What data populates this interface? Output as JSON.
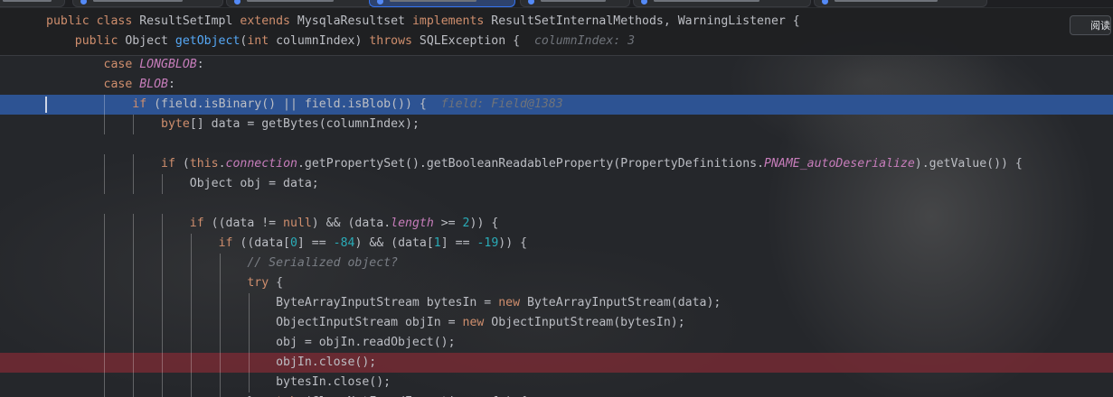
{
  "editor": {
    "tabs": [
      {
        "label": ""
      },
      {
        "label": ""
      },
      {
        "label": ""
      },
      {
        "label": ""
      },
      {
        "label": ""
      },
      {
        "label": ""
      },
      {
        "label": ""
      }
    ],
    "reader_button_label": "阅读",
    "sticky_lines": [
      [
        {
          "t": "public class ",
          "c": "kw"
        },
        {
          "t": "ResultSetImpl "
        },
        {
          "t": "extends ",
          "c": "kw"
        },
        {
          "t": "MysqlaResultset "
        },
        {
          "t": "implements ",
          "c": "kw"
        },
        {
          "t": "ResultSetInternalMethods, WarningListener {"
        }
      ],
      [
        {
          "t": "    "
        },
        {
          "t": "public ",
          "c": "kw"
        },
        {
          "t": "Object "
        },
        {
          "t": "getObject",
          "c": "fn"
        },
        {
          "t": "("
        },
        {
          "t": "int ",
          "c": "kw"
        },
        {
          "t": "columnIndex) "
        },
        {
          "t": "throws ",
          "c": "kw"
        },
        {
          "t": "SQLException {  "
        },
        {
          "t": "columnIndex: 3",
          "c": "hint"
        }
      ]
    ],
    "lines": [
      [
        {
          "t": "        "
        },
        {
          "t": "case ",
          "c": "kw"
        },
        {
          "t": "LONGBLOB",
          "c": "con"
        },
        {
          "t": ":"
        }
      ],
      [
        {
          "t": "        "
        },
        {
          "t": "case ",
          "c": "kw"
        },
        {
          "t": "BLOB",
          "c": "con"
        },
        {
          "t": ":"
        }
      ],
      [
        {
          "t": "            "
        },
        {
          "t": "if ",
          "c": "kw"
        },
        {
          "t": "(field.isBinary() || field.isBlob()) {  "
        },
        {
          "t": "field: Field@1383",
          "c": "hint"
        }
      ],
      [
        {
          "t": "                "
        },
        {
          "t": "byte",
          "c": "kw"
        },
        {
          "t": "[] data = getBytes(columnIndex);"
        }
      ],
      [],
      [
        {
          "t": "                "
        },
        {
          "t": "if ",
          "c": "kw"
        },
        {
          "t": "("
        },
        {
          "t": "this",
          "c": "kw"
        },
        {
          "t": "."
        },
        {
          "t": "connection",
          "c": "con"
        },
        {
          "t": ".getPropertySet().getBooleanReadableProperty(PropertyDefinitions."
        },
        {
          "t": "PNAME_autoDeserialize",
          "c": "con"
        },
        {
          "t": ").getValue()) {"
        }
      ],
      [
        {
          "t": "                    Object obj = data;"
        }
      ],
      [],
      [
        {
          "t": "                    "
        },
        {
          "t": "if ",
          "c": "kw"
        },
        {
          "t": "((data != "
        },
        {
          "t": "null",
          "c": "kw"
        },
        {
          "t": ") && (data."
        },
        {
          "t": "length",
          "c": "con"
        },
        {
          "t": " >= "
        },
        {
          "t": "2",
          "c": "num"
        },
        {
          "t": ")) {"
        }
      ],
      [
        {
          "t": "                        "
        },
        {
          "t": "if ",
          "c": "kw"
        },
        {
          "t": "((data["
        },
        {
          "t": "0",
          "c": "num"
        },
        {
          "t": "] == "
        },
        {
          "t": "-84",
          "c": "num"
        },
        {
          "t": ") && (data["
        },
        {
          "t": "1",
          "c": "num"
        },
        {
          "t": "] == "
        },
        {
          "t": "-19",
          "c": "num"
        },
        {
          "t": ")) {"
        }
      ],
      [
        {
          "t": "                            "
        },
        {
          "t": "// Serialized object?",
          "c": "cmt"
        }
      ],
      [
        {
          "t": "                            "
        },
        {
          "t": "try ",
          "c": "kw"
        },
        {
          "t": "{"
        }
      ],
      [
        {
          "t": "                                ByteArrayInputStream bytesIn = "
        },
        {
          "t": "new ",
          "c": "kw"
        },
        {
          "t": "ByteArrayInputStream(data);"
        }
      ],
      [
        {
          "t": "                                ObjectInputStream objIn = "
        },
        {
          "t": "new ",
          "c": "kw"
        },
        {
          "t": "ObjectInputStream(bytesIn);"
        }
      ],
      [
        {
          "t": "                                obj = objIn.readObject();"
        }
      ],
      [
        {
          "t": "                                objIn.close();"
        }
      ],
      [
        {
          "t": "                                bytesIn.close();"
        }
      ],
      [
        {
          "t": "                            } "
        },
        {
          "t": "catch ",
          "c": "kw"
        },
        {
          "t": "(ClassNotFoundException cnfe) {"
        }
      ]
    ],
    "execution_line_index": 2,
    "breakpoint_line_index": 15,
    "colors": {
      "keyword": "#cf8e6d",
      "method": "#56a8f5",
      "constant_field": "#c77dbb",
      "number": "#2aacb8",
      "comment": "#7a7e85",
      "inlay_hint": "#6f737a",
      "execution_highlight": "#2d5393",
      "breakpoint_highlight": "#742a34"
    }
  }
}
